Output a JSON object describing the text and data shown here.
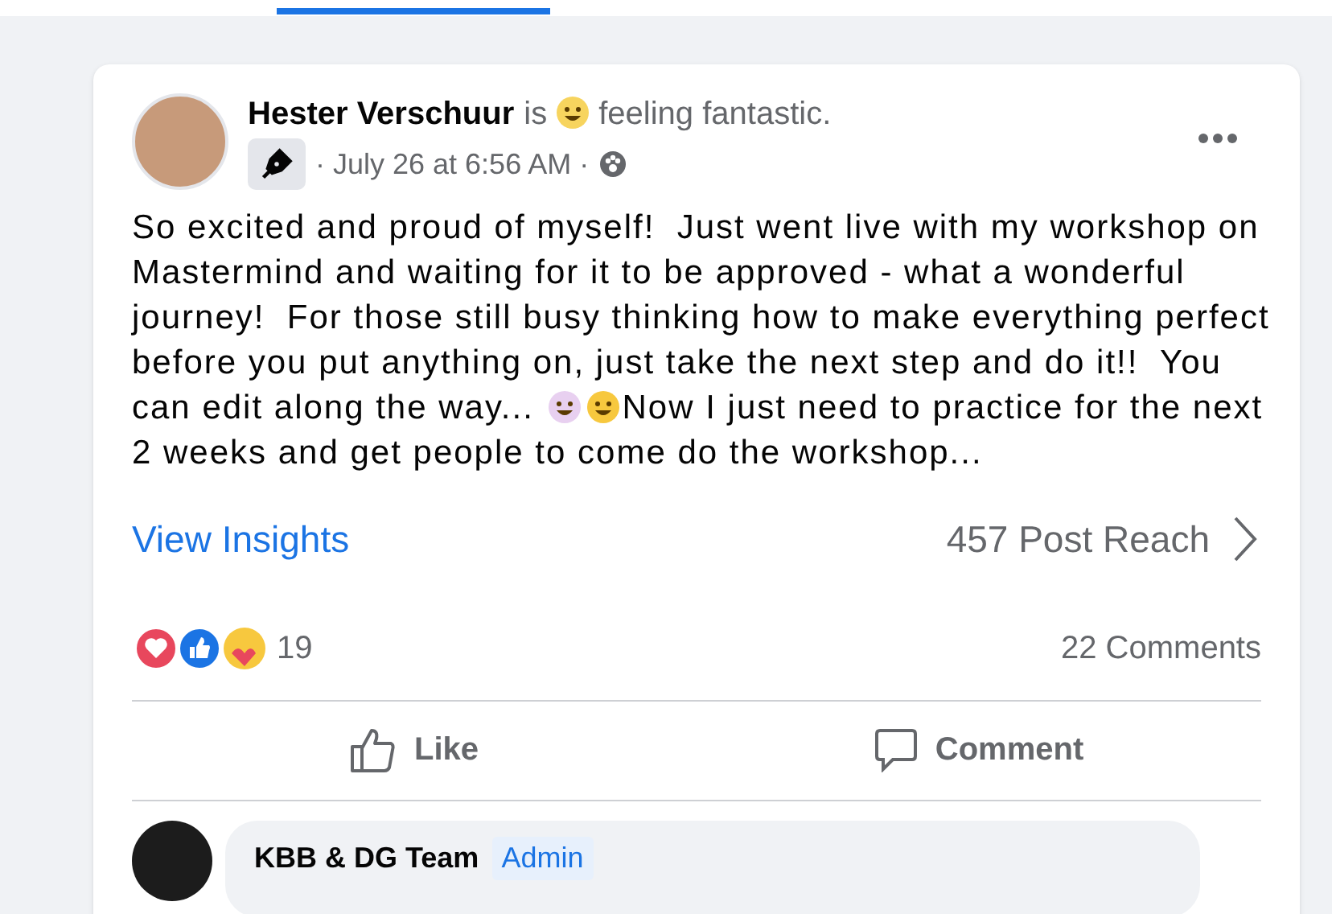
{
  "post": {
    "author": "Hester Verschuur",
    "verb": "is",
    "feeling": "feeling fantastic.",
    "time": "· July 26 at 6:56 AM ·",
    "body_before": "So excited and proud of myself!  Just went live with my workshop on Mastermind and waiting for it to be approved - what a wonderful journey!  For those still busy thinking how to make everything perfect before you put anything on, just take the next step and do it!!  You can edit along the way... ",
    "body_after": "Now I just need to practice for the next 2 weeks and get people to come do the workshop...",
    "insights": "View Insights",
    "reach": "457 Post Reach",
    "reaction_count": "19",
    "comments": "22 Comments",
    "actions": [
      {
        "kind": "like",
        "label": "Like"
      },
      {
        "kind": "comment",
        "label": "Comment"
      }
    ]
  },
  "comment": {
    "author": "KBB & DG Team",
    "badge": "Admin"
  }
}
